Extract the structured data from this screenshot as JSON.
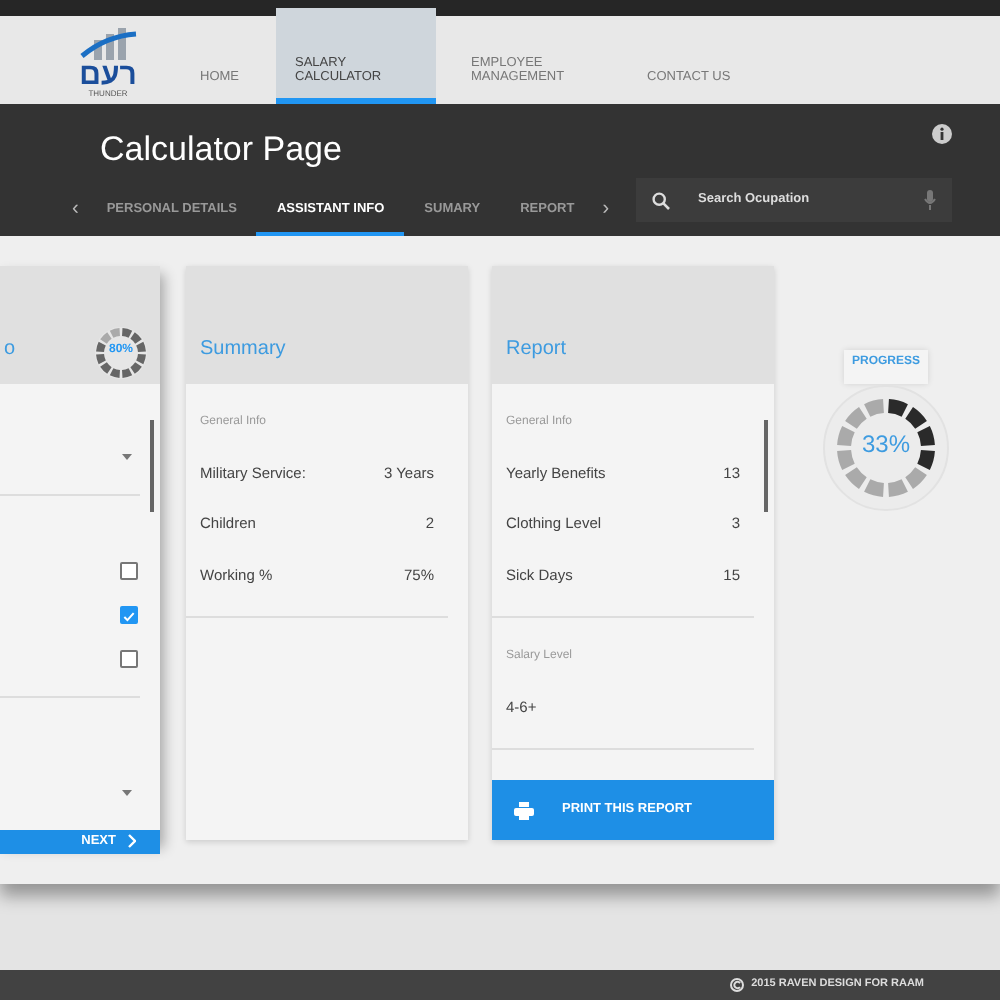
{
  "nav": {
    "logo_text": "רעם",
    "logo_subtext": "THUNDER",
    "items": [
      {
        "label": "HOME",
        "selected": false
      },
      {
        "label": "SALARY CALCULATOR",
        "selected": true
      },
      {
        "label": "EMPLOYEE MANAGEMENT",
        "selected": false
      },
      {
        "label": "CONTACT US",
        "selected": false
      }
    ]
  },
  "header": {
    "title": "Calculator Page",
    "prev": "‹",
    "next": "›",
    "tabs": [
      {
        "label": "PERSONAL DETAILS",
        "selected": false
      },
      {
        "label": "ASSISTANT INFO",
        "selected": true
      },
      {
        "label": "SUMARY",
        "selected": false
      },
      {
        "label": "REPORT",
        "selected": false
      }
    ],
    "search": {
      "placeholder": "Search Ocupation"
    }
  },
  "assistant_card": {
    "title": "o",
    "progress": {
      "label": "80%"
    },
    "rows": [
      {
        "kind": "dropdown"
      },
      {
        "kind": "checkbox",
        "checked": false
      },
      {
        "kind": "checkbox",
        "checked": true
      },
      {
        "kind": "checkbox",
        "checked": false
      },
      {
        "kind": "dropdown"
      }
    ],
    "next_button": "NEXT"
  },
  "summary_card": {
    "title": "Summary",
    "section": "General Info",
    "rows": [
      {
        "label": "Military Service:",
        "value": "3 Years"
      },
      {
        "label": "Children",
        "value": "2"
      },
      {
        "label": "Working %",
        "value": "75%"
      }
    ]
  },
  "report_card": {
    "title": "Report",
    "sections": [
      {
        "heading": "General Info",
        "rows": [
          {
            "label": "Yearly Benefits",
            "value": "13"
          },
          {
            "label": "Clothing Level",
            "value": "3"
          },
          {
            "label": "Sick Days",
            "value": "15"
          }
        ]
      },
      {
        "heading": "Salary Level",
        "rows": [
          {
            "label": "4-6+"
          }
        ]
      }
    ],
    "print_button": "PRINT THIS REPORT"
  },
  "progress": {
    "label": "PROGRESS",
    "value": "33%"
  },
  "footer": "2015 RAVEN DESIGN FOR RAAM"
}
